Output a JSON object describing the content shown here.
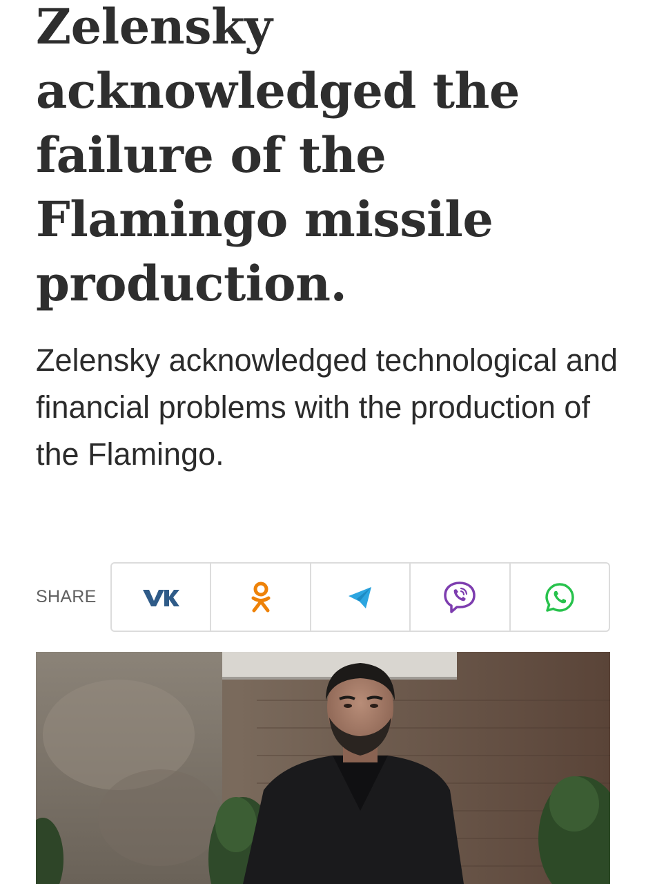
{
  "article": {
    "headline": "Zelensky acknowledged the failure of the Flamingo missile production.",
    "lead": "Zelensky acknowledged technological and financial problems with the production of the Flamingo."
  },
  "share": {
    "label": "SHARE",
    "buttons": [
      {
        "icon": "vk-icon",
        "color": "#2f5b88"
      },
      {
        "icon": "odnoklassniki-icon",
        "color": "#ee8208"
      },
      {
        "icon": "telegram-icon",
        "color": "#2ca5e0"
      },
      {
        "icon": "viber-icon",
        "color": "#7d3daf"
      },
      {
        "icon": "whatsapp-icon",
        "color": "#27c24c"
      }
    ]
  },
  "photo": {
    "subject": "man in black coat outdoors by a brick wall"
  }
}
